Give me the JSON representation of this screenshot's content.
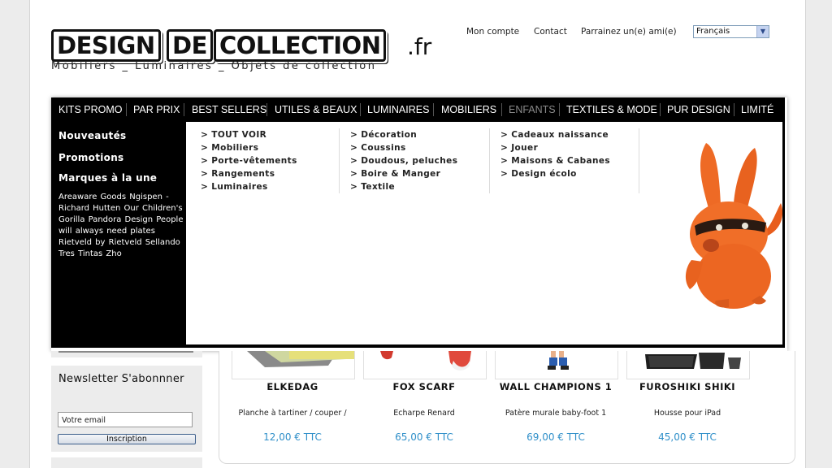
{
  "header": {
    "logo": {
      "word1": "DESIGN",
      "word2": "DE",
      "word3": "COLLECTION",
      "tld": ".fr"
    },
    "tagline": "Mobiliers _ Luminaires _ Objets de collection",
    "links": [
      "Mon compte",
      "Contact",
      "Parrainez un(e) ami(e)"
    ],
    "language": "Français"
  },
  "nav": {
    "items": [
      "KITS PROMO",
      "PAR PRIX",
      "BEST SELLERS",
      "UTILES & BEAUX",
      "LUMINAIRES",
      "MOBILIERS",
      "ENFANTS",
      "TEXTILES & MODE",
      "PUR DESIGN",
      "LIMITÉ"
    ],
    "active": "ENFANTS"
  },
  "left_menu": {
    "nouveautes": "Nouveautés",
    "promotions": "Promotions",
    "marques_title": "Marques à la une",
    "brands": "Areaware  Goods  Ngispen - Richard Hutten  Our Children's Gorilla  Pandora Design  People will always need plates  Rietveld by Rietveld  Sellando  Tres Tintas  Zho"
  },
  "mega_menu": {
    "col1": [
      "> TOUT VOIR",
      "> Mobiliers",
      "> Porte-vêtements",
      "> Rangements",
      "> Luminaires"
    ],
    "col2": [
      "> Décoration",
      "> Coussins",
      "> Doudous, peluches",
      "> Boire & Manger",
      "> Textile"
    ],
    "col3": [
      "> Cadeaux naissance",
      "> Jouer",
      "> Maisons & Cabanes",
      "> Design écolo"
    ]
  },
  "newsletter": {
    "title": "Newsletter S'abonnner",
    "placeholder": "Votre email",
    "button": "Inscription"
  },
  "products": [
    {
      "name": "ELKEDAG",
      "desc": "Planche à tartiner / couper /",
      "price": "12,00 € TTC"
    },
    {
      "name": "FOX SCARF",
      "desc": "Echarpe Renard",
      "price": "65,00 € TTC"
    },
    {
      "name": "WALL CHAMPIONS 1",
      "desc": "Patère murale baby-foot 1",
      "price": "69,00 € TTC"
    },
    {
      "name": "FUROSHIKI SHIKI",
      "desc": "Housse pour iPad",
      "price": "45,00 € TTC"
    }
  ],
  "colors": {
    "price": "#2f8fc9",
    "nav_bg": "#000000",
    "nav_active": "#8a8a8a"
  }
}
